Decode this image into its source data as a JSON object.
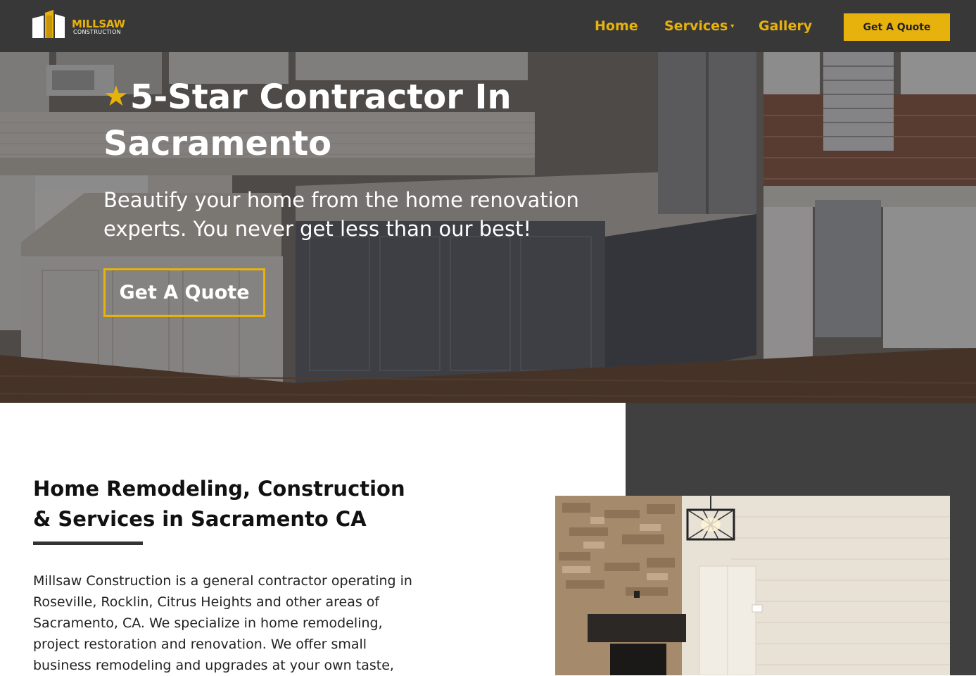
{
  "header": {
    "logo": {
      "word": "MILLSAW",
      "sub": "CONSTRUCTION"
    },
    "nav": [
      {
        "label": "Home"
      },
      {
        "label": "Services",
        "caret": "▾"
      },
      {
        "label": "Gallery"
      }
    ],
    "cta_label": "Get A Quote"
  },
  "hero": {
    "star_icon": "★",
    "title": "5-Star Contractor In Sacramento",
    "subtitle": "Beautify your home from the home renovation experts. You never get less than our best!",
    "cta_label": "Get A Quote"
  },
  "intro": {
    "title": "Home Remodeling, Construction & Services in Sacramento CA",
    "body": "Millsaw Construction is a general contractor operating in Roseville, Rocklin, Citrus Heights and other areas of Sacramento, CA. We specialize in home remodeling, project restoration and renovation. We offer small business remodeling and upgrades at your own taste,"
  },
  "colors": {
    "accent": "#e8b20d",
    "header_bg": "#383838",
    "panel_bg": "#404040"
  }
}
